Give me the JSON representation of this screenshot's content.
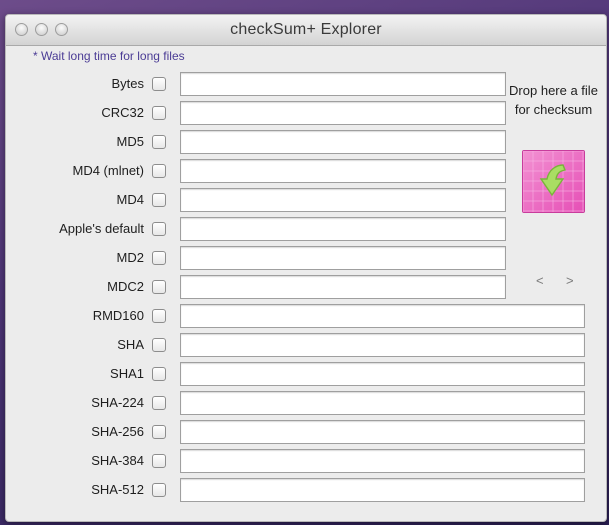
{
  "window": {
    "title": "checkSum+ Explorer"
  },
  "note": "* Wait long time for long files",
  "fields": [
    {
      "label": "Bytes",
      "value": ""
    },
    {
      "label": "CRC32",
      "value": ""
    },
    {
      "label": "MD5",
      "value": ""
    },
    {
      "label": "MD4 (mlnet)",
      "value": ""
    },
    {
      "label": "MD4",
      "value": ""
    },
    {
      "label": "Apple's default",
      "value": ""
    },
    {
      "label": "MD2",
      "value": ""
    },
    {
      "label": "MDC2",
      "value": ""
    },
    {
      "label": "RMD160",
      "value": ""
    },
    {
      "label": "SHA",
      "value": ""
    },
    {
      "label": "SHA1",
      "value": ""
    },
    {
      "label": "SHA-224",
      "value": ""
    },
    {
      "label": "SHA-256",
      "value": ""
    },
    {
      "label": "SHA-384",
      "value": ""
    },
    {
      "label": "SHA-512",
      "value": ""
    }
  ],
  "drop": {
    "text": "Drop here a file for checksum",
    "icon": "drop-arrow-icon"
  },
  "nav": {
    "prev": "<",
    "next": ">"
  },
  "colors": {
    "note": "#4b3c95",
    "drop_pink": "#e64fb6",
    "arrow_green": "#a9dd63"
  }
}
